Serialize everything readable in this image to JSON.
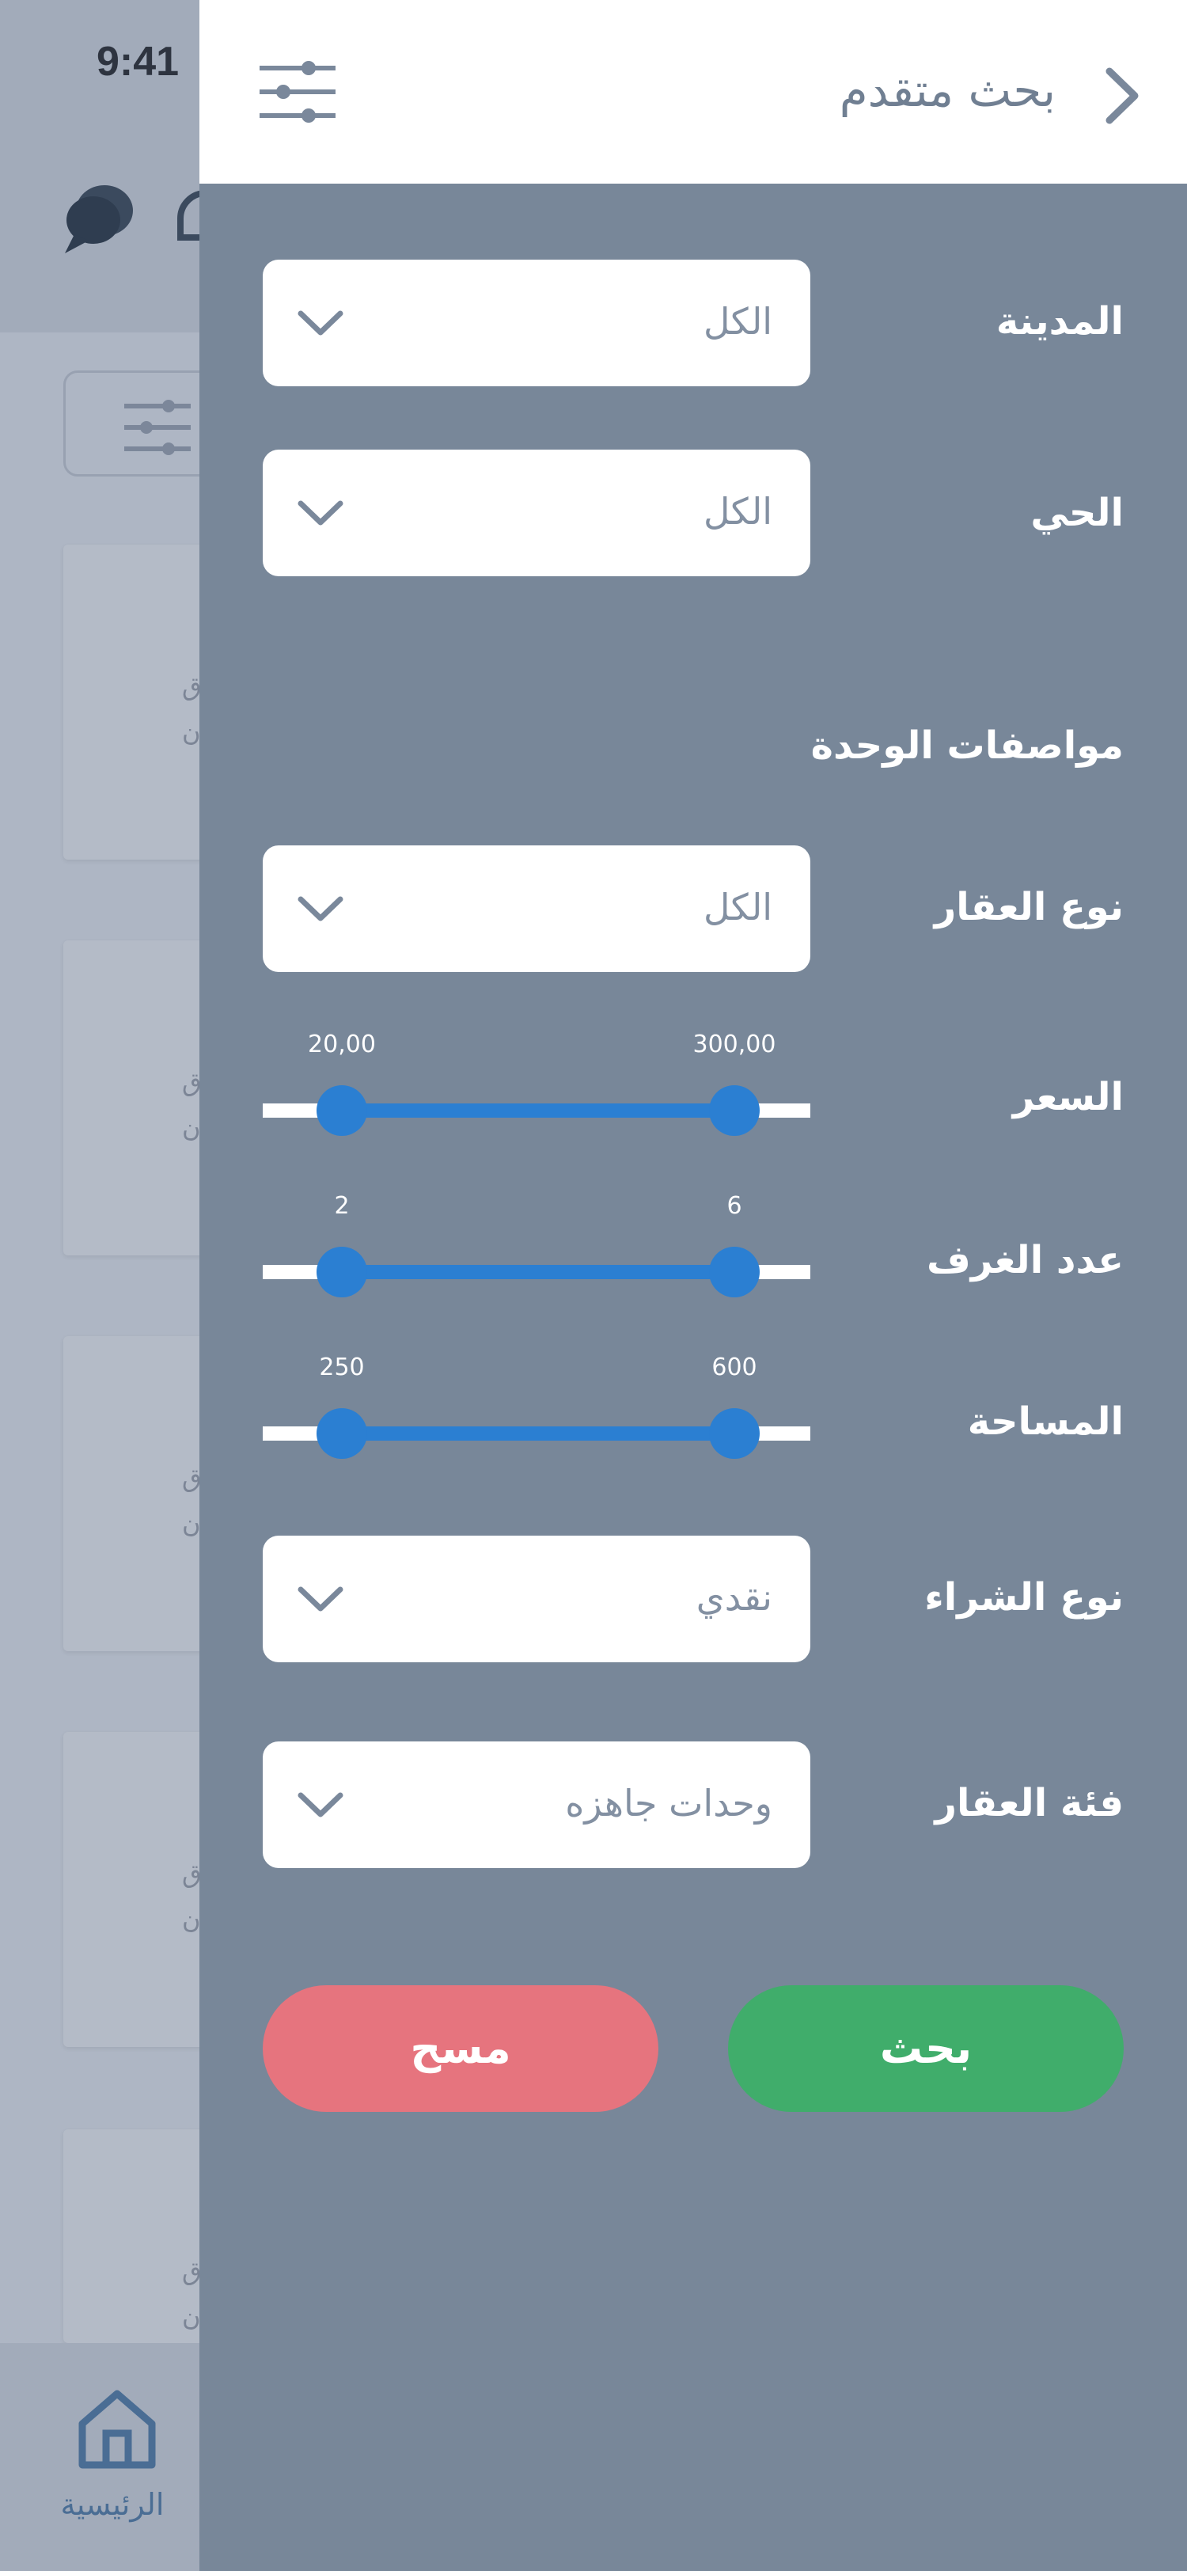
{
  "status_bar": {
    "time": "9:41"
  },
  "background": {
    "card_lines": [
      {
        "line1": "ق,",
        "line2": "ن"
      },
      {
        "line1": "ق,",
        "line2": "ن"
      },
      {
        "line1": "ق,",
        "line2": "ن"
      },
      {
        "line1": "ق,",
        "line2": "ن"
      },
      {
        "line1": "ق,",
        "line2": "ن"
      }
    ],
    "bottom_nav": {
      "home_label": "الرئيسية"
    }
  },
  "drawer": {
    "title": "بحث متقدم",
    "fields": {
      "city": {
        "label": "المدينة",
        "value": "الكل"
      },
      "district": {
        "label": "الحي",
        "value": "الكل"
      },
      "section_title": "مواصفات الوحدة",
      "property_type": {
        "label": "نوع العقار",
        "value": "الكل"
      },
      "price": {
        "label": "السعر",
        "min_label": "20,00",
        "max_label": "300,00"
      },
      "rooms": {
        "label": "عدد الغرف",
        "min_label": "2",
        "max_label": "6"
      },
      "area": {
        "label": "المساحة",
        "min_label": "250",
        "max_label": "600"
      },
      "purchase_type": {
        "label": "نوع الشراء",
        "value": "نقدي"
      },
      "property_category": {
        "label": "فئة العقار",
        "value": "وحدات جاهزه"
      }
    },
    "buttons": {
      "search": "بحث",
      "clear": "مسح"
    }
  },
  "colors": {
    "drawer_bg": "#788799",
    "slider_accent": "#2b7fd2",
    "search_button": "#40ad6b",
    "clear_button": "#e6747e"
  }
}
